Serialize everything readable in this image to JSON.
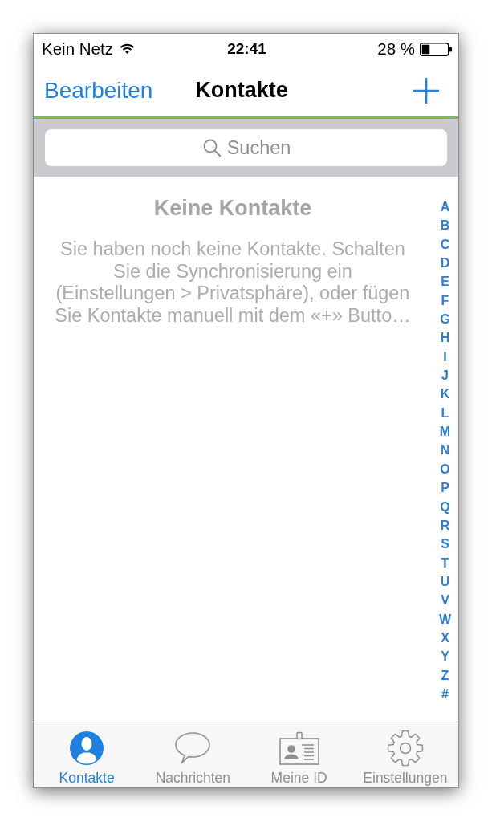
{
  "status_bar": {
    "carrier": "Kein Netz",
    "time": "22:41",
    "battery": "28 %"
  },
  "nav_bar": {
    "left_button": "Bearbeiten",
    "title": "Kontakte"
  },
  "search": {
    "placeholder": "Suchen"
  },
  "empty_state": {
    "title": "Keine Kontakte",
    "message": "Sie haben noch keine Kontakte. Schalten\nSie die Synchronisierung ein\n(Einstellungen > Privatsphäre), oder fügen\nSie Kontakte manuell mit dem «+» Butto…"
  },
  "index": [
    "A",
    "B",
    "C",
    "D",
    "E",
    "F",
    "G",
    "H",
    "I",
    "J",
    "K",
    "L",
    "M",
    "N",
    "O",
    "P",
    "Q",
    "R",
    "S",
    "T",
    "U",
    "V",
    "W",
    "X",
    "Y",
    "Z",
    "#"
  ],
  "tabs": [
    {
      "label": "Kontakte",
      "kind": "contacts",
      "selected": true
    },
    {
      "label": "Nachrichten",
      "kind": "messages",
      "selected": false
    },
    {
      "label": "Meine ID",
      "kind": "id_card",
      "selected": false
    },
    {
      "label": "Einstellungen",
      "kind": "settings",
      "selected": false
    }
  ]
}
